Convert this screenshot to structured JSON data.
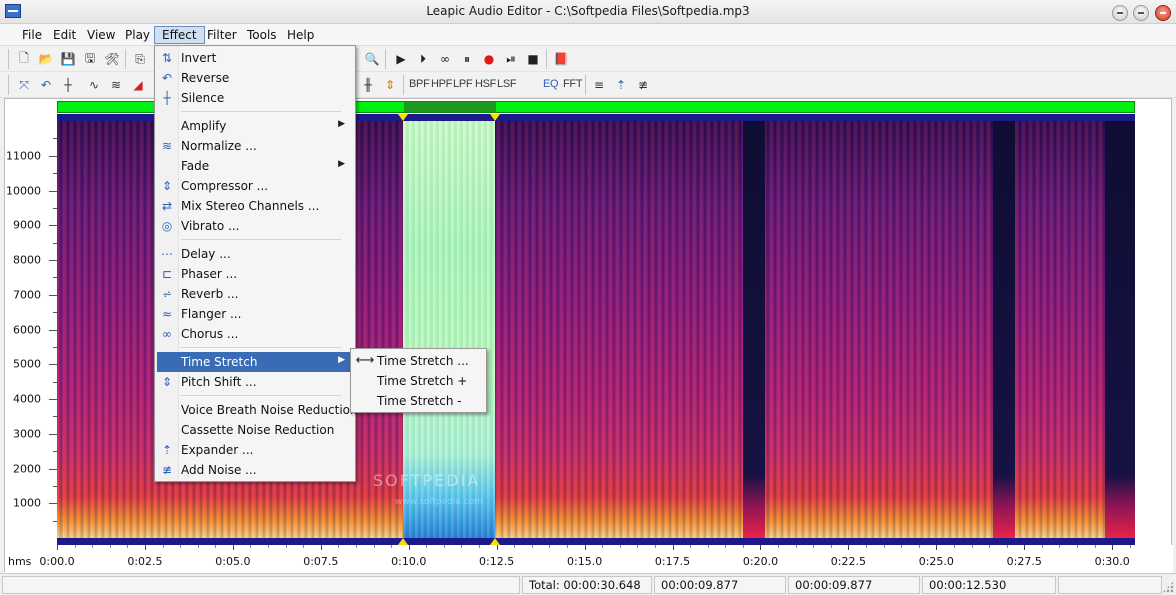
{
  "window": {
    "title": "Leapic Audio Editor - C:\\Softpedia Files\\Softpedia.mp3"
  },
  "menubar": [
    "File",
    "Edit",
    "View",
    "Play",
    "Effect",
    "Filter",
    "Tools",
    "Help"
  ],
  "toolbar2_text": [
    "BPF",
    "HPF",
    "LPF",
    "HSF",
    "LSF",
    "EQ",
    "FFT"
  ],
  "effect_menu": {
    "items": [
      {
        "label": "Invert",
        "icon": "invert-icon"
      },
      {
        "label": "Reverse",
        "icon": "reverse-icon"
      },
      {
        "label": "Silence",
        "icon": "silence-icon"
      },
      {
        "label": "Amplify",
        "icon": "",
        "submenu": true
      },
      {
        "label": "Normalize ...",
        "icon": "normalize-icon"
      },
      {
        "label": "Fade",
        "icon": "",
        "submenu": true
      },
      {
        "label": "Compressor ...",
        "icon": "compressor-icon"
      },
      {
        "label": "Mix Stereo Channels ...",
        "icon": "mix-stereo-icon"
      },
      {
        "label": "Vibrato ...",
        "icon": "vibrato-icon"
      },
      {
        "label": "Delay ...",
        "icon": "delay-icon"
      },
      {
        "label": "Phaser ...",
        "icon": "phaser-icon"
      },
      {
        "label": "Reverb ...",
        "icon": "reverb-icon"
      },
      {
        "label": "Flanger ...",
        "icon": "flanger-icon"
      },
      {
        "label": "Chorus ...",
        "icon": "chorus-icon"
      },
      {
        "label": "Time Stretch",
        "icon": "",
        "submenu": true,
        "highlighted": true
      },
      {
        "label": "Pitch Shift ...",
        "icon": "pitch-shift-icon"
      },
      {
        "label": "Voice Breath Noise Reduction",
        "icon": ""
      },
      {
        "label": "Cassette Noise Reduction",
        "icon": ""
      },
      {
        "label": "Expander ...",
        "icon": "expander-icon"
      },
      {
        "label": "Add Noise ...",
        "icon": "add-noise-icon"
      }
    ]
  },
  "time_stretch_submenu": [
    "Time Stretch ...",
    "Time Stretch +",
    "Time Stretch -"
  ],
  "frequency_axis": [
    "11000",
    "10000",
    "9000",
    "8000",
    "7000",
    "6000",
    "5000",
    "4000",
    "3000",
    "2000",
    "1000"
  ],
  "time_axis": {
    "units": "hms",
    "labels": [
      "0:00.0",
      "0:02.5",
      "0:05.0",
      "0:07.5",
      "0:10.0",
      "0:12.5",
      "0:15.0",
      "0:17.5",
      "0:20.0",
      "0:22.5",
      "0:25.0",
      "0:27.5",
      "0:30.0"
    ]
  },
  "status": {
    "total": "Total: 00:00:30.648",
    "sel_start": "00:00:09.877",
    "cursor": "00:00:09.877",
    "sel_end": "00:00:12.530"
  },
  "watermark": {
    "main": "SOFTPEDIA",
    "sub": "www.softpedia.com"
  },
  "colors": {
    "selection_highlight": "#3a6bb5",
    "overview": "#00f010",
    "marker": "#f6e000"
  }
}
